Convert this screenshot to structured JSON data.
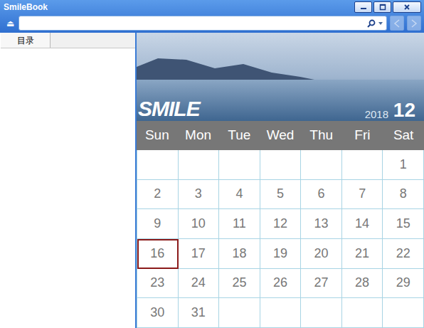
{
  "window": {
    "title": "SmileBook",
    "controls": [
      {
        "kind": "minimize"
      },
      {
        "kind": "maximize"
      },
      {
        "kind": "close"
      }
    ]
  },
  "toolbar": {
    "eject": "⏏",
    "search": {
      "value": ""
    },
    "nav": [
      {
        "kind": "back",
        "disabled": true
      },
      {
        "kind": "forward",
        "disabled": true
      }
    ]
  },
  "sidebar": {
    "tabs": [
      {
        "label": "目录",
        "selected": true
      }
    ]
  },
  "calendar": {
    "logo": "SMILE",
    "year": "2018",
    "month": "12",
    "weekdays": [
      "Sun",
      "Mon",
      "Tue",
      "Wed",
      "Thu",
      "Fri",
      "Sat"
    ],
    "weeks": [
      [
        {
          "day": "",
          "selected": false
        },
        {
          "day": "",
          "selected": false
        },
        {
          "day": "",
          "selected": false
        },
        {
          "day": "",
          "selected": false
        },
        {
          "day": "",
          "selected": false
        },
        {
          "day": "",
          "selected": false
        },
        {
          "day": "1",
          "selected": false
        }
      ],
      [
        {
          "day": "2",
          "selected": false
        },
        {
          "day": "3",
          "selected": false
        },
        {
          "day": "4",
          "selected": false
        },
        {
          "day": "5",
          "selected": false
        },
        {
          "day": "6",
          "selected": false
        },
        {
          "day": "7",
          "selected": false
        },
        {
          "day": "8",
          "selected": false
        }
      ],
      [
        {
          "day": "9",
          "selected": false
        },
        {
          "day": "10",
          "selected": false
        },
        {
          "day": "11",
          "selected": false
        },
        {
          "day": "12",
          "selected": false
        },
        {
          "day": "13",
          "selected": false
        },
        {
          "day": "14",
          "selected": false
        },
        {
          "day": "15",
          "selected": false
        }
      ],
      [
        {
          "day": "16",
          "selected": true
        },
        {
          "day": "17",
          "selected": false
        },
        {
          "day": "18",
          "selected": false
        },
        {
          "day": "19",
          "selected": false
        },
        {
          "day": "20",
          "selected": false
        },
        {
          "day": "21",
          "selected": false
        },
        {
          "day": "22",
          "selected": false
        }
      ],
      [
        {
          "day": "23",
          "selected": false
        },
        {
          "day": "24",
          "selected": false
        },
        {
          "day": "25",
          "selected": false
        },
        {
          "day": "26",
          "selected": false
        },
        {
          "day": "27",
          "selected": false
        },
        {
          "day": "28",
          "selected": false
        },
        {
          "day": "29",
          "selected": false
        }
      ],
      [
        {
          "day": "30",
          "selected": false
        },
        {
          "day": "31",
          "selected": false
        },
        {
          "day": "",
          "selected": false
        },
        {
          "day": "",
          "selected": false
        },
        {
          "day": "",
          "selected": false
        },
        {
          "day": "",
          "selected": false
        },
        {
          "day": "",
          "selected": false
        }
      ]
    ]
  }
}
